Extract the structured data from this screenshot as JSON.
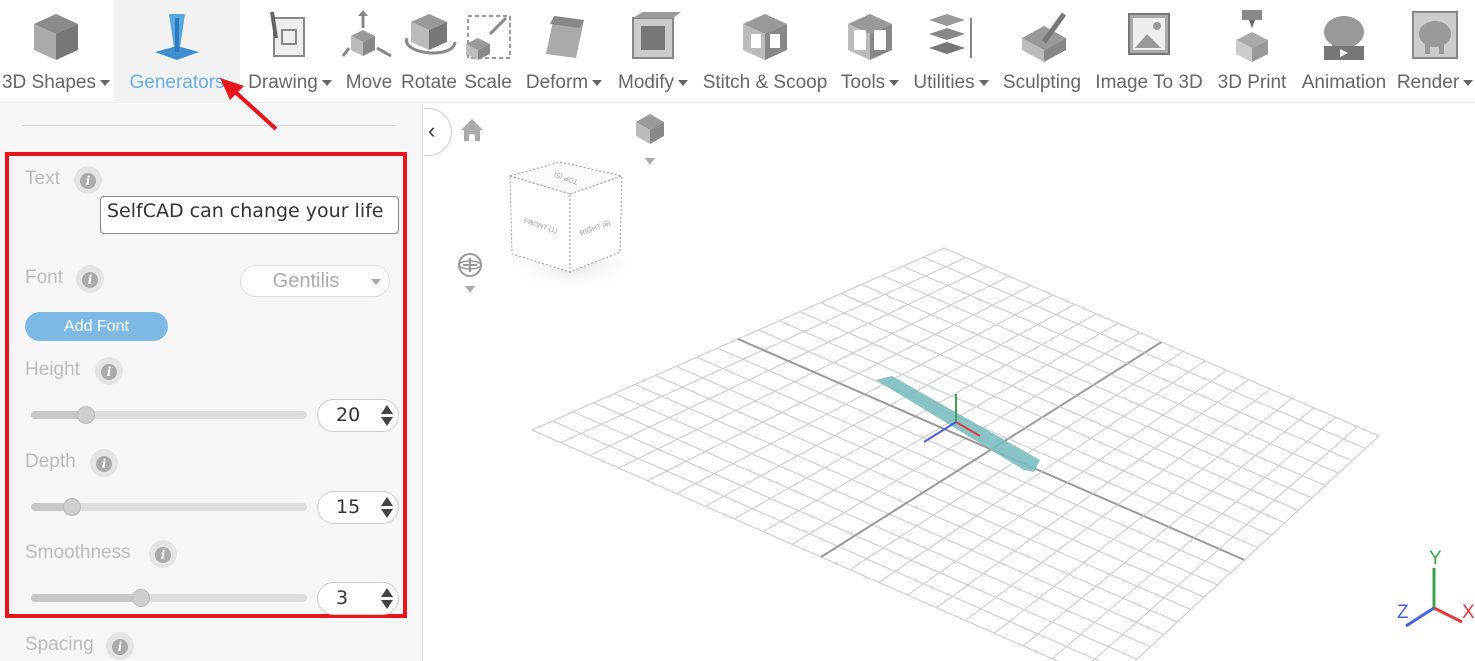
{
  "toolbar": {
    "items": [
      {
        "label": "3D Shapes",
        "dropdown": true,
        "icon": "cube-icon"
      },
      {
        "label": "Generators",
        "dropdown": false,
        "icon": "generator-icon",
        "active": true
      },
      {
        "label": "Drawing",
        "dropdown": true,
        "icon": "drawing-icon"
      },
      {
        "label": "Move",
        "dropdown": false,
        "icon": "move-icon"
      },
      {
        "label": "Rotate",
        "dropdown": false,
        "icon": "rotate-icon"
      },
      {
        "label": "Scale",
        "dropdown": false,
        "icon": "scale-icon"
      },
      {
        "label": "Deform",
        "dropdown": true,
        "icon": "deform-icon"
      },
      {
        "label": "Modify",
        "dropdown": true,
        "icon": "modify-icon"
      },
      {
        "label": "Stitch & Scoop",
        "dropdown": false,
        "icon": "stitch-scoop-icon"
      },
      {
        "label": "Tools",
        "dropdown": true,
        "icon": "tools-icon"
      },
      {
        "label": "Utilities",
        "dropdown": true,
        "icon": "utilities-icon"
      },
      {
        "label": "Sculpting",
        "dropdown": false,
        "icon": "sculpting-icon"
      },
      {
        "label": "Image To 3D",
        "dropdown": false,
        "icon": "image-to-3d-icon"
      },
      {
        "label": "3D Print",
        "dropdown": false,
        "icon": "3d-print-icon"
      },
      {
        "label": "Animation",
        "dropdown": false,
        "icon": "animation-icon"
      },
      {
        "label": "Render",
        "dropdown": true,
        "icon": "render-icon"
      }
    ]
  },
  "panel": {
    "text_label": "Text",
    "text_value": "SelfCAD can change your life",
    "font_label": "Font",
    "font_value": "Gentilis",
    "add_font_label": "Add Font",
    "height_label": "Height",
    "height_value": "20",
    "height_level": 0.2,
    "depth_label": "Depth",
    "depth_value": "15",
    "depth_level": 0.15,
    "smoothness_label": "Smoothness",
    "smoothness_value": "3",
    "smoothness_level": 0.4,
    "spacing_label": "Spacing"
  },
  "viewport": {
    "cube": {
      "top": "TOP (5)",
      "front": "FRONT (1)",
      "right": "RIGHT (6)"
    },
    "axes": {
      "x": "X",
      "y": "Y",
      "z": "Z"
    },
    "axis_colors": {
      "x": "#e33b3b",
      "y": "#3fa34d",
      "z": "#4a5fe0"
    }
  },
  "colors": {
    "accent": "#6aaee5",
    "highlight": "#e8141b",
    "button": "#7eb9e6"
  }
}
